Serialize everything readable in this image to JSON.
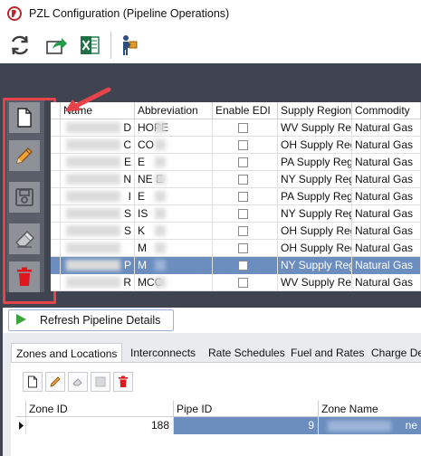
{
  "window": {
    "title": "PZL Configuration (Pipeline Operations)"
  },
  "toolbar": {
    "icons": [
      "refresh-icon",
      "export-icon",
      "excel-icon",
      "user-delivery-icon"
    ]
  },
  "side_actions": [
    "new-document-icon",
    "edit-pencil-icon",
    "save-floppy-icon",
    "eraser-icon",
    "delete-trash-icon"
  ],
  "grid": {
    "columns": [
      "Name",
      "Abbreviation",
      "Enable EDI",
      "Supply Region",
      "Commodity"
    ],
    "rows": [
      {
        "name_tail": "D",
        "abbr": "HOPE",
        "edi": false,
        "region": "WV Supply Reg",
        "commodity": "Natural Gas"
      },
      {
        "name_tail": "C",
        "abbr": "CO",
        "edi": false,
        "region": "OH Supply Reg",
        "commodity": "Natural Gas"
      },
      {
        "name_tail": "E",
        "abbr": "E",
        "edi": false,
        "region": "PA Supply Regi",
        "commodity": "Natural Gas"
      },
      {
        "name_tail": "N",
        "abbr": "NE E",
        "edi": false,
        "region": "NY Supply Reg",
        "commodity": "Natural Gas"
      },
      {
        "name_tail": "I",
        "abbr": "E",
        "edi": false,
        "region": "PA Supply Regi",
        "commodity": "Natural Gas"
      },
      {
        "name_tail": "S",
        "abbr": "IS",
        "edi": false,
        "region": "NY Supply Reg",
        "commodity": "Natural Gas"
      },
      {
        "name_tail": "S",
        "abbr": "K",
        "edi": false,
        "region": "OH Supply Reg",
        "commodity": "Natural Gas"
      },
      {
        "name_tail": "",
        "abbr": "M",
        "edi": false,
        "region": "OH Supply Reg",
        "commodity": "Natural Gas"
      },
      {
        "name_tail": "P",
        "abbr": "M",
        "edi": false,
        "region": "NY Supply Reg",
        "commodity": "Natural Gas",
        "selected": true
      },
      {
        "name_tail": "R",
        "abbr": "MCC",
        "edi": false,
        "region": "WV Supply Reg",
        "commodity": "Natural Gas"
      }
    ]
  },
  "refresh_button": {
    "label": "Refresh Pipeline Details"
  },
  "tabs": [
    "Zones and Locations",
    "Interconnects",
    "Rate Schedules",
    "Fuel and Rates",
    "Charge De"
  ],
  "zones_grid": {
    "columns": [
      "Zone ID",
      "Pipe ID",
      "Zone Name"
    ],
    "row": {
      "zone_id": "188",
      "pipe_id": "9",
      "zone_name_tail": "ne"
    }
  },
  "colors": {
    "highlight_red": "#e8434a",
    "selection_blue": "#6c8ebf",
    "workspace_dark": "#3f4450"
  }
}
